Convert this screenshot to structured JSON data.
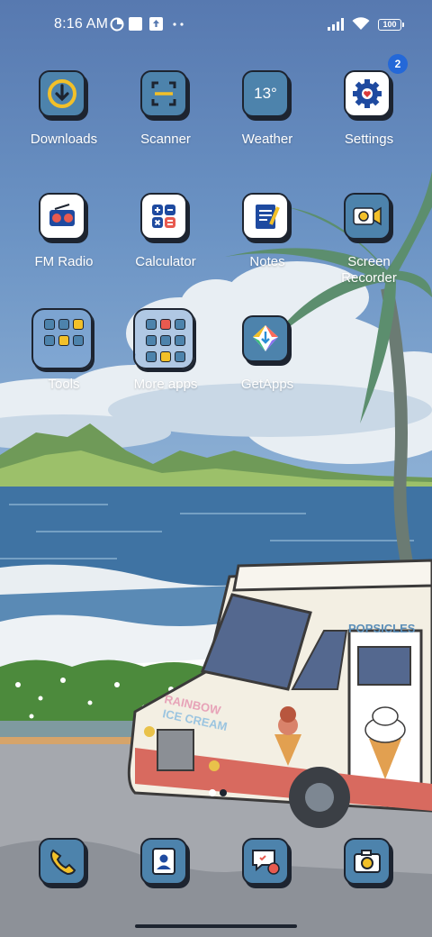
{
  "status_bar": {
    "time": "8:16 AM",
    "battery": "100"
  },
  "grid": [
    {
      "name": "downloads",
      "label": "Downloads",
      "icon": "download-icon",
      "badge": ""
    },
    {
      "name": "scanner",
      "label": "Scanner",
      "icon": "scan-icon",
      "badge": ""
    },
    {
      "name": "weather",
      "label": "Weather",
      "icon": "weather-icon",
      "tile_text": "13°",
      "badge": ""
    },
    {
      "name": "settings",
      "label": "Settings",
      "icon": "gear-icon",
      "badge": "2"
    },
    {
      "name": "fm-radio",
      "label": "FM Radio",
      "icon": "radio-icon"
    },
    {
      "name": "calculator",
      "label": "Calculator",
      "icon": "calculator-icon"
    },
    {
      "name": "notes",
      "label": "Notes",
      "icon": "notes-icon"
    },
    {
      "name": "screen-recorder",
      "label_line1": "Screen",
      "label_line2": "Recorder",
      "icon": "video-camera-icon"
    },
    {
      "name": "tools",
      "label": "Tools",
      "icon": "folder-icon"
    },
    {
      "name": "more-apps",
      "label": "More apps",
      "icon": "folder-icon"
    },
    {
      "name": "getapps",
      "label": "GetApps",
      "icon": "getapps-icon"
    }
  ],
  "dock": [
    {
      "name": "phone",
      "icon": "phone-icon"
    },
    {
      "name": "contacts",
      "icon": "contacts-icon"
    },
    {
      "name": "messages",
      "icon": "messages-icon"
    },
    {
      "name": "camera",
      "icon": "camera-icon"
    }
  ],
  "wallpaper": {
    "truck_sign": "POPSICLES",
    "truck_text_1": "RAINBOW",
    "truck_text_2": "ICE CREAM"
  },
  "colors": {
    "sky": "#5b83b8",
    "tile_blue": "#4d83ac",
    "badge": "#2468d8",
    "outline": "#1d2430"
  }
}
